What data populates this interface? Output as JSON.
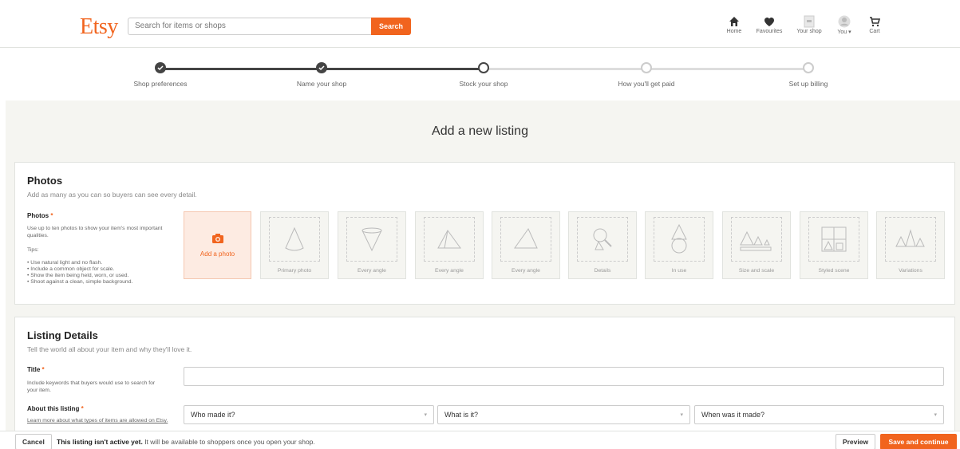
{
  "header": {
    "logo": "Etsy",
    "search_placeholder": "Search for items or shops",
    "search_button": "Search",
    "nav": [
      {
        "label": "Home",
        "icon": "home-icon"
      },
      {
        "label": "Favourites",
        "icon": "heart-icon"
      },
      {
        "label": "Your shop",
        "icon": "shop-icon"
      },
      {
        "label": "You ▾",
        "icon": "avatar-icon"
      },
      {
        "label": "Cart",
        "icon": "cart-icon"
      }
    ]
  },
  "progress": {
    "steps": [
      {
        "label": "Shop preferences",
        "state": "done"
      },
      {
        "label": "Name your shop",
        "state": "done"
      },
      {
        "label": "Stock your shop",
        "state": "current"
      },
      {
        "label": "How you'll get paid",
        "state": "future"
      },
      {
        "label": "Set up billing",
        "state": "future"
      }
    ]
  },
  "page_title": "Add a new listing",
  "photos": {
    "title": "Photos",
    "subtitle": "Add as many as you can so buyers can see every detail.",
    "field_label": "Photos",
    "required_mark": "*",
    "hint": "Use up to ten photos to show your item's most important qualities.",
    "tips_label": "Tips:",
    "tips": [
      "Use natural light and no flash.",
      "Include a common object for scale.",
      "Show the item being held, worn, or used.",
      "Shoot against a clean, simple background."
    ],
    "add_photo_label": "Add a photo",
    "slots": [
      "Primary photo",
      "Every angle",
      "Every angle",
      "Every angle",
      "Details",
      "In use",
      "Size and scale",
      "Styled scene",
      "Variations"
    ]
  },
  "details": {
    "title": "Listing Details",
    "subtitle": "Tell the world all about your item and why they'll love it.",
    "title_label": "Title",
    "title_hint": "Include keywords that buyers would use to search for your item.",
    "about_label": "About this listing",
    "about_link": "Learn more about what types of items are allowed on Etsy.",
    "selects": [
      "Who made it?",
      "What is it?",
      "When was it made?"
    ]
  },
  "footer": {
    "cancel": "Cancel",
    "message_bold": "This listing isn't active yet.",
    "message_rest": " It will be available to shoppers once you open your shop.",
    "preview": "Preview",
    "save": "Save and continue"
  },
  "colors": {
    "accent": "#f1641e",
    "background": "#f5f5f1"
  }
}
